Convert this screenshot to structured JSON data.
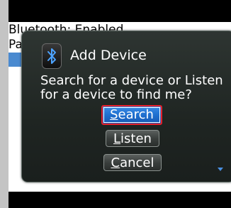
{
  "screen": {
    "status_text": "Bluetooth: Enabled",
    "list_item_fragment": "Pa"
  },
  "dialog": {
    "icon": "bluetooth-icon",
    "title": "Add Device",
    "message": "Search for a device or Listen for a device to find me?",
    "buttons": {
      "search": {
        "first": "S",
        "rest": "earch"
      },
      "listen": {
        "first": "L",
        "rest": "isten"
      },
      "cancel": {
        "first": "C",
        "rest": "ancel"
      }
    }
  },
  "colors": {
    "focus_border": "#e8202a",
    "focus_fill": "#1e6fcf",
    "scroll_indicator": "#4a90e2"
  }
}
